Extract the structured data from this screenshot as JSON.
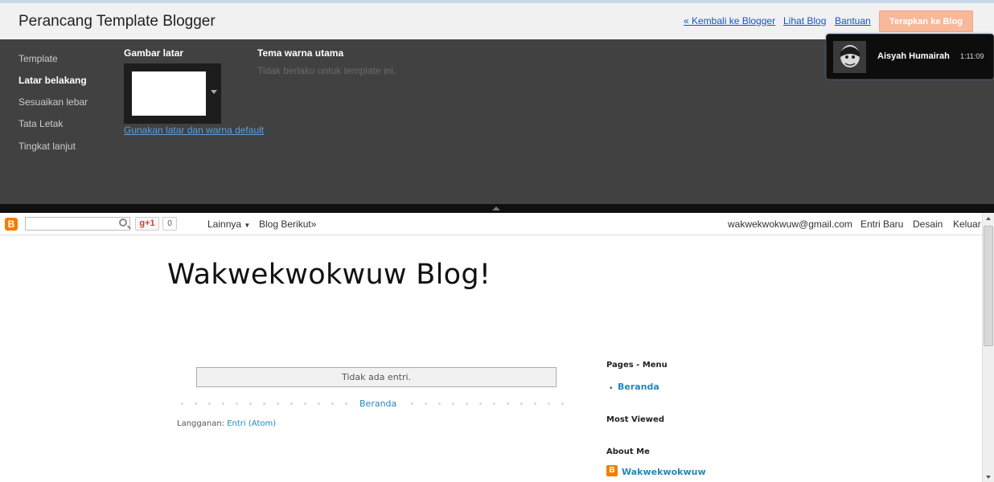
{
  "header": {
    "title": "Perancang Template Blogger",
    "links": {
      "back": "« Kembali ke Blogger",
      "view": "Lihat Blog",
      "help": "Bantuan"
    },
    "apply_label": "Terapkan ke Blog",
    "apply_color": "#f8b89a"
  },
  "designer": {
    "nav": [
      "Template",
      "Latar belakang",
      "Sesuaikan lebar",
      "Tata Letak",
      "Tingkat lanjut"
    ],
    "active_nav": "Latar belakang",
    "background": {
      "heading": "Gambar latar",
      "default_link": "Gunakan latar dan warna default"
    },
    "theme": {
      "heading": "Tema warna utama",
      "note": "Tidak berlaku untuk template ini."
    }
  },
  "notification": {
    "name": "Aisyah Humairah",
    "time": "1:11:09"
  },
  "navbar": {
    "plusone": "g+1",
    "plusone_count": "0",
    "more": "Lainnya",
    "next_blog": "Blog Berikut»",
    "email": "wakwekwokwuw@gmail.com",
    "new_post": "Entri Baru",
    "design": "Desain",
    "logout": "Keluar"
  },
  "blog": {
    "title": "Wakwekwokwuw Blog!",
    "no_posts": "Tidak ada entri.",
    "home_link": "Beranda",
    "subscribe_label": "Langganan:",
    "subscribe_link": "Entri (Atom)"
  },
  "sidebar": {
    "pages_heading": "Pages - Menu",
    "pages_items": [
      "Beranda"
    ],
    "most_viewed_heading": "Most Viewed",
    "about_heading": "About Me",
    "about_name": "Wakwekwokwuw"
  },
  "colors": {
    "designer_bg": "#414141",
    "link_blue": "#2288bb",
    "blogger_orange": "#f57d00"
  }
}
